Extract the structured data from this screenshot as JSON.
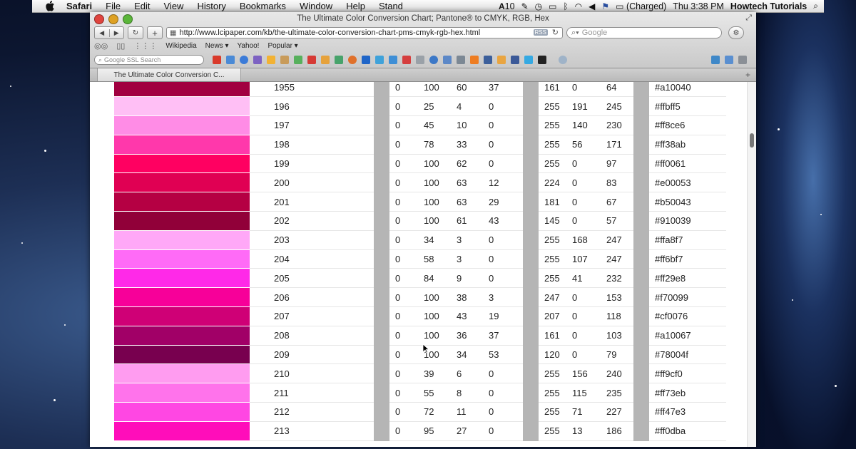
{
  "menubar": {
    "app": "Safari",
    "menus": [
      "File",
      "Edit",
      "View",
      "History",
      "Bookmarks",
      "Window",
      "Help",
      "Stand"
    ],
    "status_num": "10",
    "battery": "(Charged)",
    "clock": "Thu 3:38 PM",
    "user": "Howtech Tutorials"
  },
  "window": {
    "title": "The Ultimate Color Conversion Chart; Pantone® to CMYK, RGB, Hex",
    "url": "http://www.lcipaper.com/kb/the-ultimate-color-conversion-chart-pms-cmyk-rgb-hex.html",
    "rss": "RSS",
    "search_placeholder": "Google",
    "bookmarks": [
      "Wikipedia",
      "News ▾",
      "Yahoo!",
      "Popular ▾"
    ],
    "google_ssl_placeholder": "Google SSL Search",
    "tab_label": "The Ultimate Color Conversion C..."
  },
  "rows": [
    {
      "color": "#a10040",
      "code": "1955",
      "c": "0",
      "m": "100",
      "y": "60",
      "k": "37",
      "r": "161",
      "g": "0",
      "b": "64",
      "hex": "#a10040"
    },
    {
      "color": "#ffbff5",
      "code": "196",
      "c": "0",
      "m": "25",
      "y": "4",
      "k": "0",
      "r": "255",
      "g": "191",
      "b": "245",
      "hex": "#ffbff5"
    },
    {
      "color": "#ff8ce6",
      "code": "197",
      "c": "0",
      "m": "45",
      "y": "10",
      "k": "0",
      "r": "255",
      "g": "140",
      "b": "230",
      "hex": "#ff8ce6"
    },
    {
      "color": "#ff38ab",
      "code": "198",
      "c": "0",
      "m": "78",
      "y": "33",
      "k": "0",
      "r": "255",
      "g": "56",
      "b": "171",
      "hex": "#ff38ab"
    },
    {
      "color": "#ff0061",
      "code": "199",
      "c": "0",
      "m": "100",
      "y": "62",
      "k": "0",
      "r": "255",
      "g": "0",
      "b": "97",
      "hex": "#ff0061"
    },
    {
      "color": "#e00053",
      "code": "200",
      "c": "0",
      "m": "100",
      "y": "63",
      "k": "12",
      "r": "224",
      "g": "0",
      "b": "83",
      "hex": "#e00053"
    },
    {
      "color": "#b50043",
      "code": "201",
      "c": "0",
      "m": "100",
      "y": "63",
      "k": "29",
      "r": "181",
      "g": "0",
      "b": "67",
      "hex": "#b50043"
    },
    {
      "color": "#910039",
      "code": "202",
      "c": "0",
      "m": "100",
      "y": "61",
      "k": "43",
      "r": "145",
      "g": "0",
      "b": "57",
      "hex": "#910039"
    },
    {
      "color": "#ffa8f7",
      "code": "203",
      "c": "0",
      "m": "34",
      "y": "3",
      "k": "0",
      "r": "255",
      "g": "168",
      "b": "247",
      "hex": "#ffa8f7"
    },
    {
      "color": "#ff6bf7",
      "code": "204",
      "c": "0",
      "m": "58",
      "y": "3",
      "k": "0",
      "r": "255",
      "g": "107",
      "b": "247",
      "hex": "#ff6bf7"
    },
    {
      "color": "#ff29e8",
      "code": "205",
      "c": "0",
      "m": "84",
      "y": "9",
      "k": "0",
      "r": "255",
      "g": "41",
      "b": "232",
      "hex": "#ff29e8"
    },
    {
      "color": "#f70099",
      "code": "206",
      "c": "0",
      "m": "100",
      "y": "38",
      "k": "3",
      "r": "247",
      "g": "0",
      "b": "153",
      "hex": "#f70099"
    },
    {
      "color": "#cf0076",
      "code": "207",
      "c": "0",
      "m": "100",
      "y": "43",
      "k": "19",
      "r": "207",
      "g": "0",
      "b": "118",
      "hex": "#cf0076"
    },
    {
      "color": "#a10067",
      "code": "208",
      "c": "0",
      "m": "100",
      "y": "36",
      "k": "37",
      "r": "161",
      "g": "0",
      "b": "103",
      "hex": "#a10067"
    },
    {
      "color": "#78004f",
      "code": "209",
      "c": "0",
      "m": "100",
      "y": "34",
      "k": "53",
      "r": "120",
      "g": "0",
      "b": "79",
      "hex": "#78004f"
    },
    {
      "color": "#ff9cf0",
      "code": "210",
      "c": "0",
      "m": "39",
      "y": "6",
      "k": "0",
      "r": "255",
      "g": "156",
      "b": "240",
      "hex": "#ff9cf0"
    },
    {
      "color": "#ff73eb",
      "code": "211",
      "c": "0",
      "m": "55",
      "y": "8",
      "k": "0",
      "r": "255",
      "g": "115",
      "b": "235",
      "hex": "#ff73eb"
    },
    {
      "color": "#ff47e3",
      "code": "212",
      "c": "0",
      "m": "72",
      "y": "11",
      "k": "0",
      "r": "255",
      "g": "71",
      "b": "227",
      "hex": "#ff47e3"
    },
    {
      "color": "#ff0dba",
      "code": "213",
      "c": "0",
      "m": "95",
      "y": "27",
      "k": "0",
      "r": "255",
      "g": "13",
      "b": "186",
      "hex": "#ff0dba"
    }
  ]
}
